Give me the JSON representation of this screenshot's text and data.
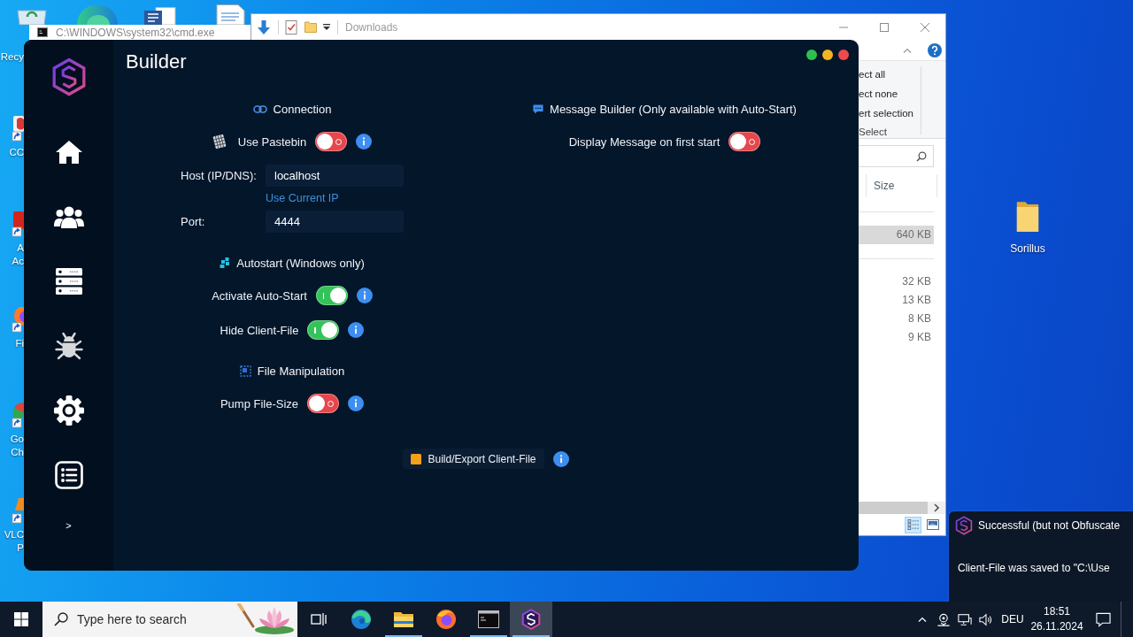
{
  "desktop": {
    "recycle_bin": {
      "label": "Recy"
    },
    "icons": [
      {
        "kind": "ccleaner",
        "label": [
          "CC"
        ]
      },
      {
        "kind": "acrobat",
        "label": [
          "A",
          "Ac"
        ]
      },
      {
        "kind": "firefox",
        "label": [
          "Fi"
        ]
      },
      {
        "kind": "chrome",
        "label": [
          "Go",
          "Ch"
        ]
      },
      {
        "kind": "vlc",
        "label": [
          "VLC",
          "P"
        ]
      }
    ],
    "folder": {
      "label": "Sorillus"
    }
  },
  "cmd_window": {
    "title": "C:\\WINDOWS\\system32\\cmd.exe"
  },
  "explorer": {
    "title": "Downloads",
    "ribbon": {
      "items": [
        "ect all",
        "ect none",
        "ert selection"
      ],
      "group": "Select"
    },
    "columns": [
      "Size"
    ],
    "groups": [
      {
        "rows": [
          {
            "size": "640 KB",
            "selected": true
          }
        ]
      },
      {
        "rows": [
          {
            "size": "32 KB",
            "selected": false
          },
          {
            "size": "13 KB",
            "selected": false
          },
          {
            "size": "8 KB",
            "selected": false
          },
          {
            "size": "9 KB",
            "selected": false
          }
        ]
      }
    ],
    "view_buttons": [
      {
        "kind": "details",
        "selected": true
      },
      {
        "kind": "large_icons",
        "selected": false
      }
    ]
  },
  "builder": {
    "title": "Builder",
    "window_controls": [
      {
        "color": "#2ec04f"
      },
      {
        "color": "#f5b324"
      },
      {
        "color": "#ef4a4f"
      }
    ],
    "nav": [
      {
        "kind": "home"
      },
      {
        "kind": "users"
      },
      {
        "kind": "server"
      },
      {
        "kind": "bug"
      },
      {
        "kind": "settings"
      },
      {
        "kind": "list"
      }
    ],
    "expand_label": ">",
    "columns": [
      {
        "sections": [
          {
            "heading": "Connection",
            "items": [
              {
                "kind": "toggle",
                "label": "Use Pastebin",
                "on": false,
                "info": true
              },
              {
                "kind": "field",
                "label": "Host (IP/DNS):",
                "value": "localhost"
              },
              {
                "kind": "link",
                "label": "Use Current IP"
              },
              {
                "kind": "field",
                "label": "Port:",
                "value": "4444"
              }
            ]
          },
          {
            "heading": "Autostart (Windows only)",
            "items": [
              {
                "kind": "toggle",
                "label": "Activate Auto-Start",
                "on": true,
                "info": true
              },
              {
                "kind": "toggle",
                "label": "Hide Client-File",
                "on": true,
                "info": true
              }
            ]
          },
          {
            "heading": "File Manipulation",
            "items": [
              {
                "kind": "toggle",
                "label": "Pump File-Size",
                "on": false,
                "info": true
              }
            ]
          }
        ]
      },
      {
        "sections": [
          {
            "heading": "Message Builder (Only available with Auto-Start)",
            "items": [
              {
                "kind": "toggle",
                "label": "Display Message on first start",
                "on": false,
                "info": false
              }
            ]
          }
        ]
      }
    ],
    "build_button": {
      "label": "Build/Export Client-File",
      "info": true
    }
  },
  "toast": {
    "title": "Successful (but not Obfuscate",
    "message": "Client-File was saved to \"C:\\Use"
  },
  "taskbar": {
    "search": {
      "placeholder": "Type here to search"
    },
    "apps": [
      {
        "kind": "edge",
        "running": false,
        "selected": false
      },
      {
        "kind": "explorer",
        "running": true,
        "selected": false
      },
      {
        "kind": "firefox",
        "running": false,
        "selected": false
      },
      {
        "kind": "terminal",
        "running": true,
        "selected": false
      },
      {
        "kind": "sorillus",
        "running": true,
        "selected": true
      }
    ],
    "language": "DEU",
    "time": "18:51",
    "date": "26.11.2024"
  }
}
